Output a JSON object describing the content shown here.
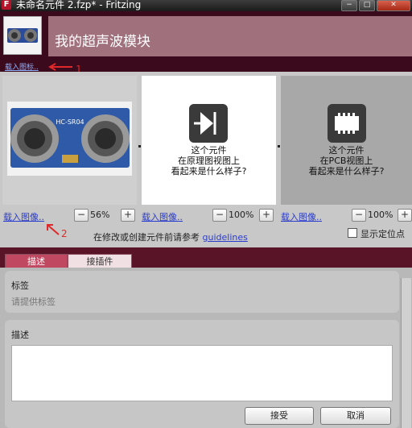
{
  "window": {
    "title": "未命名元件 2.fzp* - Fritzing",
    "app_icon": "F",
    "controls": [
      "−",
      "□",
      "✕"
    ]
  },
  "header": {
    "part_title": "我的超声波模块",
    "load_icon_label": "载入图标..",
    "annotation_1": "1"
  },
  "views": {
    "breadboard": {
      "load_label": "载入图像..",
      "zoom": "56%",
      "sensor_label": "HC-SR04"
    },
    "schematic": {
      "lines": [
        "这个元件",
        "在原理图视图上",
        "看起来是什么样子?"
      ],
      "load_label": "载入图像..",
      "zoom": "100%"
    },
    "pcb": {
      "lines": [
        "这个元件",
        "在PCB视图上",
        "看起来是什么样子?"
      ],
      "load_label": "载入图像..",
      "zoom": "100%"
    },
    "zoom_minus": "−",
    "zoom_plus": "+",
    "annotation_2": "2",
    "hint_prefix": "在修改或创建元件前请参考",
    "hint_link": "guidelines",
    "show_anchor": "显示定位点"
  },
  "tabs": [
    "描述",
    "接插件"
  ],
  "form": {
    "label_title": "标签",
    "label_placeholder": "请提供标签",
    "desc_title": "描述",
    "accept": "接受",
    "cancel": "取消"
  },
  "colors": {
    "header_bg": "#3b0a1c",
    "title_box": "#a0707c",
    "tab_active": "#c04860",
    "link": "#2a3ccc",
    "annotation": "#e0282a"
  }
}
